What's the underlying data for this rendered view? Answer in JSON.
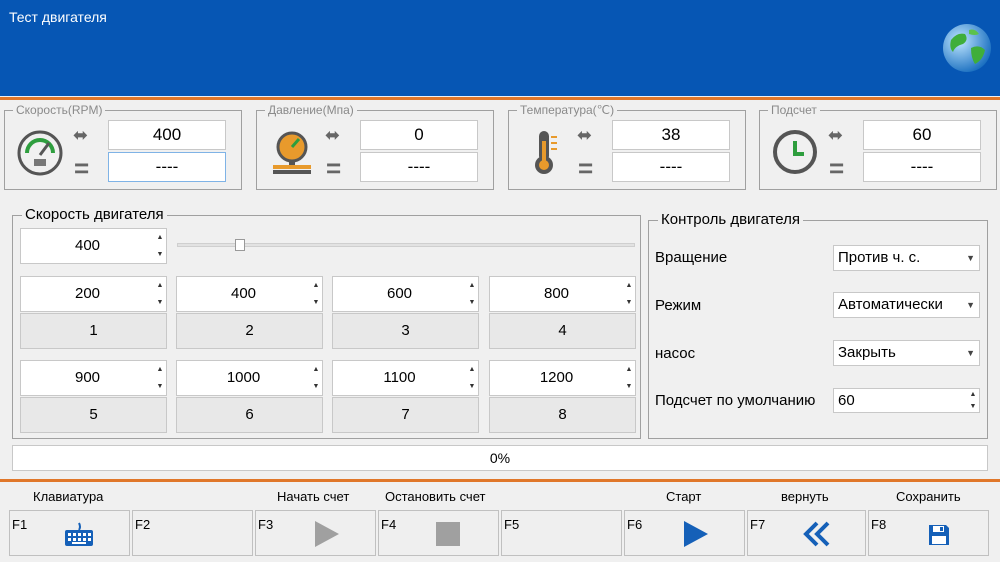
{
  "header": {
    "title": "Тест двигателя"
  },
  "sensors": [
    {
      "label": "Скорость(RPM)",
      "set": "400",
      "actual": "----",
      "icon": "speedometer-icon"
    },
    {
      "label": "Давление(Мпа)",
      "set": "0",
      "actual": "----",
      "icon": "pressure-gauge-icon"
    },
    {
      "label": "Температура(℃)",
      "set": "38",
      "actual": "----",
      "icon": "thermometer-icon"
    },
    {
      "label": "Подсчет",
      "set": "60",
      "actual": "----",
      "icon": "clock-icon"
    }
  ],
  "speed_panel": {
    "title": "Скорость двигателя",
    "current": "400",
    "slider_fraction": 0.13,
    "presets": [
      {
        "value": "200",
        "button": "1"
      },
      {
        "value": "400",
        "button": "2"
      },
      {
        "value": "600",
        "button": "3"
      },
      {
        "value": "800",
        "button": "4"
      },
      {
        "value": "900",
        "button": "5"
      },
      {
        "value": "1000",
        "button": "6"
      },
      {
        "value": "1100",
        "button": "7"
      },
      {
        "value": "1200",
        "button": "8"
      }
    ]
  },
  "control_panel": {
    "title": "Контроль двигателя",
    "rotation_label": "Вращение",
    "rotation_value": "Против ч. с.",
    "mode_label": "Режим",
    "mode_value": "Автоматически",
    "pump_label": "насос",
    "pump_value": "Закрыть",
    "count_label": "Подсчет по умолчанию",
    "count_value": "60"
  },
  "progress": {
    "text": "0%",
    "value": 0
  },
  "fkeys": [
    {
      "key": "F1",
      "label": "Клавиатура",
      "icon": "keyboard-icon"
    },
    {
      "key": "F2",
      "label": "",
      "icon": ""
    },
    {
      "key": "F3",
      "label": "Начать счет",
      "icon": "play-icon"
    },
    {
      "key": "F4",
      "label": "Остановить счет",
      "icon": "stop-icon"
    },
    {
      "key": "F5",
      "label": "",
      "icon": ""
    },
    {
      "key": "F6",
      "label": "Старт",
      "icon": "start-icon"
    },
    {
      "key": "F7",
      "label": "вернуть",
      "icon": "rewind-icon"
    },
    {
      "key": "F8",
      "label": "Сохранить",
      "icon": "save-icon"
    }
  ],
  "colors": {
    "header": "#0656b4",
    "accent_line": "#e0772a",
    "icon_blue": "#1560b8",
    "icon_gray": "#a0a0a0",
    "gauge_green": "#2e9e3e"
  }
}
